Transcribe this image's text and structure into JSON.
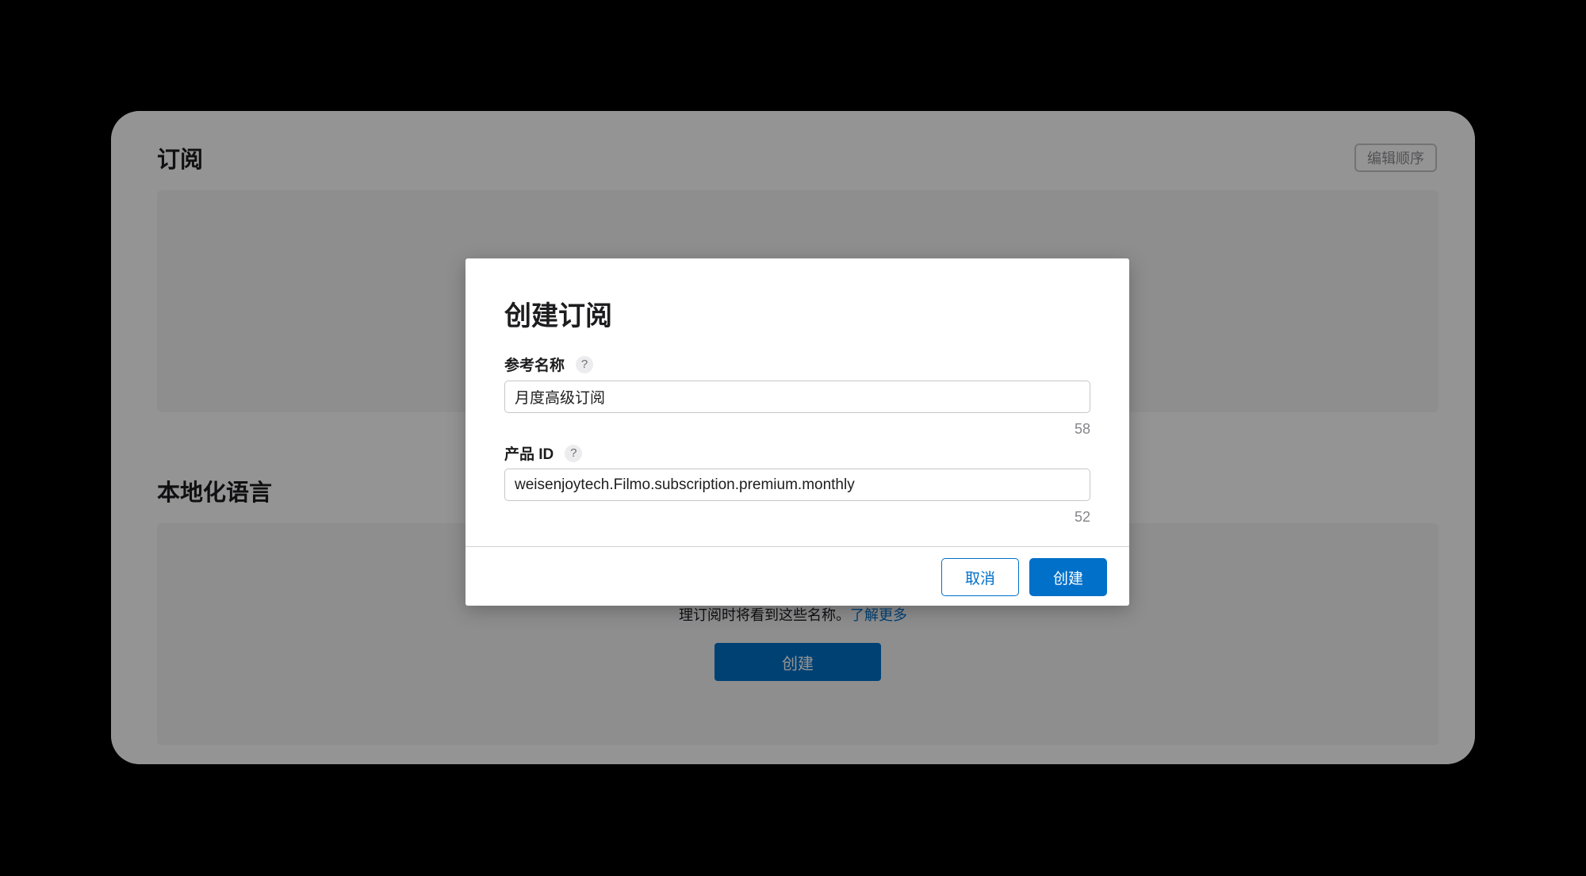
{
  "page": {
    "subscriptions_title": "订阅",
    "edit_order_label": "编辑顺序",
    "localization_title": "本地化语言",
    "localization_description": "理订阅时将看到这些名称。",
    "learn_more_link": "了解更多",
    "localization_create_label": "创建"
  },
  "modal": {
    "title": "创建订阅",
    "reference_name": {
      "label": "参考名称",
      "help_icon": "?",
      "value": "月度高级订阅",
      "remaining_chars": "58"
    },
    "product_id": {
      "label": "产品 ID",
      "help_icon": "?",
      "value": "weisenjoytech.Filmo.subscription.premium.monthly",
      "remaining_chars": "52"
    },
    "cancel_label": "取消",
    "create_label": "创建"
  },
  "colors": {
    "accent": "#0070c9",
    "backdrop": "#000000",
    "overlay": "rgba(0,0,0,0.42)"
  }
}
